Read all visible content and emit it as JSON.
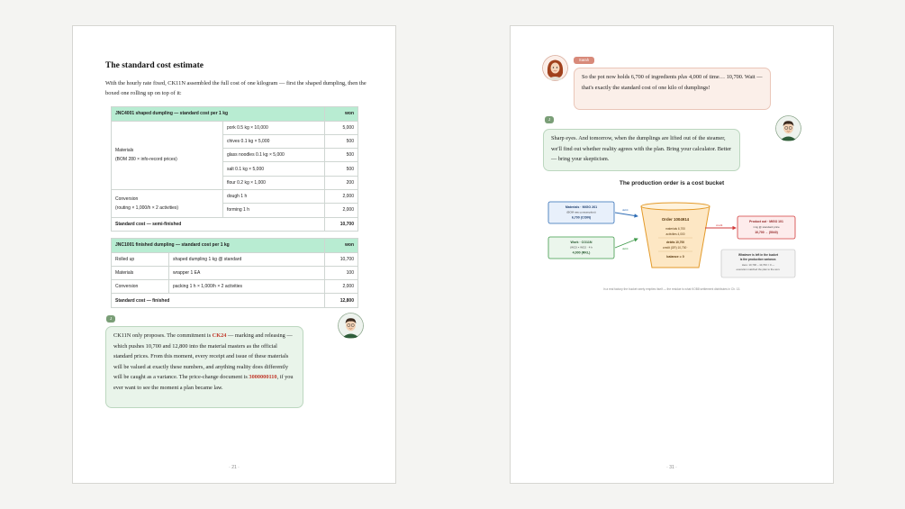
{
  "left_page": {
    "title": "The standard cost estimate",
    "intro": "With the hourly rate fixed, CK11N assembled the full cost of one kilogram — first the shaped dumpling, then the boxed one rolling up on top of it:",
    "table1": {
      "header": "JNC4001 shaped dumpling — standard cost per 1 kg",
      "won_header": "won",
      "materials_label_1": "Materials",
      "materials_label_2": "(BOM 280 × info-record prices)",
      "conversion_label_1": "Conversion",
      "conversion_label_2": "(routing × 1,000/h × 2 activities)",
      "rows": [
        {
          "item": "pork 0.5 kg × 10,000",
          "value": "5,000"
        },
        {
          "item": "chives 0.1 kg × 5,000",
          "value": "500"
        },
        {
          "item": "glass noodles 0.1 kg × 5,000",
          "value": "500"
        },
        {
          "item": "salt 0.1 kg × 5,000",
          "value": "500"
        },
        {
          "item": "flour 0.2 kg × 1,000",
          "value": "200"
        },
        {
          "item": "dough 1 h",
          "value": "2,000"
        },
        {
          "item": "forming 1 h",
          "value": "2,000"
        }
      ],
      "total_label": "Standard cost — semi-finished",
      "total_value": "10,700"
    },
    "table2": {
      "header": "JNC1001 finished dumpling — standard cost per 1 kg",
      "won_header": "won",
      "rows": [
        {
          "category": "Rolled up",
          "item": "shaped dumpling 1 kg @ standard",
          "value": "10,700"
        },
        {
          "category": "Materials",
          "item": "wrapper 1 EA",
          "value": "100"
        },
        {
          "category": "Conversion",
          "item": "packing 1 h × 1,000/h × 2 activities",
          "value": "2,000"
        }
      ],
      "total_label": "Standard cost — finished",
      "total_value": "12,800"
    },
    "speaker_tag": "J",
    "bubble": {
      "p1": "CK11N only proposes. The commitment is ",
      "code1": "CK24",
      "p2": " — marking and releasing — which pushes 10,700 and 12,800 into the material masters as the official standard prices. From this moment, every receipt and issue of these materials will be valued at exactly these numbers, and anything reality does differently will be caught as a variance. The price-change document is ",
      "code2": "3000000110",
      "p3": ", if you ever want to see the moment a plan became law."
    },
    "page_number": "· 21 ·"
  },
  "right_page": {
    "sarah_tag": "Sarah",
    "sarah_bubble_a": "So the pot now holds 6,700 of ingredients ",
    "sarah_bubble_plus": "plus",
    "sarah_bubble_b": " 4,000 of time… 10,700. Wait — that's exactly the standard cost of one kilo of dumplings!",
    "j_tag": "J",
    "j_bubble": "Sharp eyes. And tomorrow, when the dumplings are lifted out of the steamer, we'll find out whether reality agrees with the plan. Bring your calculator. Better — bring your skepticism.",
    "diagram_title": "The production order is a cost bucket",
    "diagram": {
      "materials_box": {
        "l1": "Materials · MIGO 261",
        "l2": "(BOM raw consumption)",
        "l3": "6,700 (COIN)"
      },
      "work_box": {
        "l1": "Work · CO11N",
        "l2": "(WC0 × WO2 · 4 h",
        "l3": "4,000 (RKL)"
      },
      "debit_label_1": "debit",
      "debit_label_2": "debit",
      "credit_label": "credit",
      "bucket_title": "Order 1004914",
      "bucket_lines": [
        "materials 6,700",
        "activities 4,000",
        "debits 10,700",
        "credit (GR) 10,700⁻",
        "balance = 0"
      ],
      "product_box": {
        "l1": "Product out · MIGO 101",
        "l2": "1 kg @ standard price",
        "l3": "10,700 → (5040)"
      },
      "note_box": {
        "l1": "Whatever is left in the bucket",
        "l2": "is the production variance.",
        "l3": "Here: 10,700 − 10,700 = 0 —",
        "l4": "execution matched the plan to the won."
      }
    },
    "caption": "In a real factory the bucket rarely empties itself — the residue is what KOB8 settlement distributes in Ch. 13.",
    "page_number": "· 31 ·"
  },
  "colors": {
    "table_header": "#b8ecd2",
    "j_bubble": "#e9f4ea",
    "sarah_bubble": "#fbefe9",
    "accent_red": "#c0392b",
    "blue_box": "#2f6db5",
    "green_box": "#3f9a4a",
    "bucket": "#f0a030",
    "red_box": "#d23b3b"
  },
  "icons": [
    "avatar-j",
    "avatar-sarah"
  ]
}
